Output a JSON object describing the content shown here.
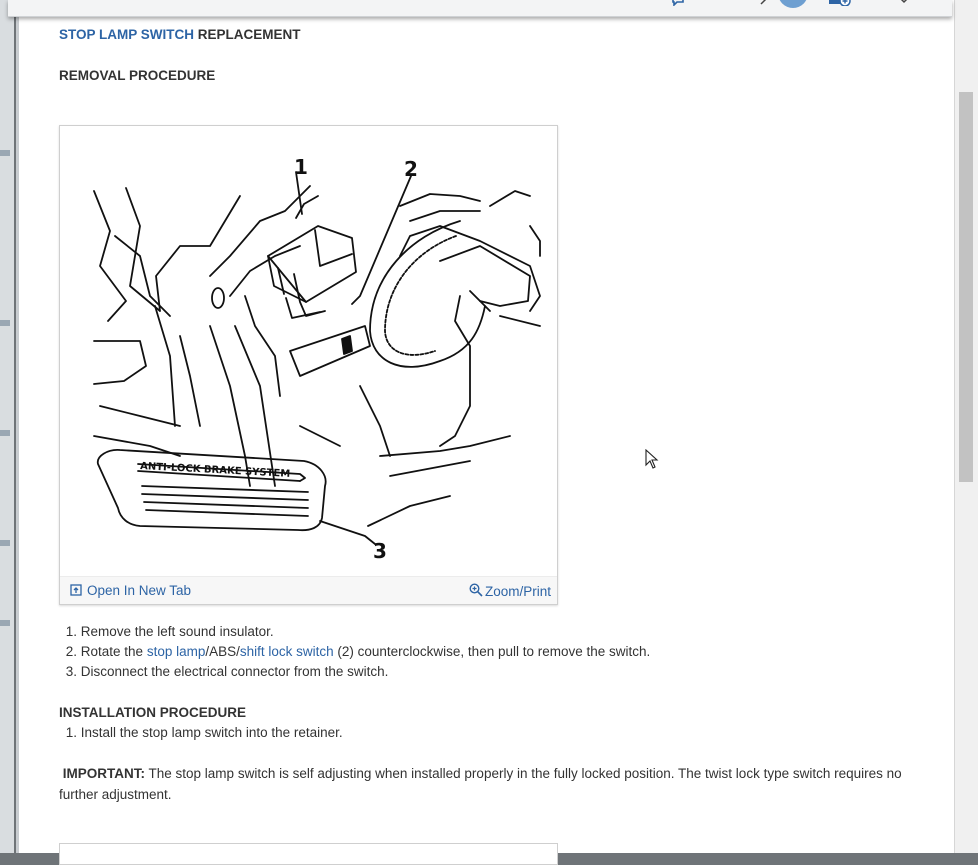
{
  "title": {
    "link_part": "STOP LAMP SWITCH",
    "rest": " REPLACEMENT"
  },
  "removal_heading": "REMOVAL PROCEDURE",
  "figure": {
    "labels": [
      "1",
      "2",
      "3"
    ],
    "panel_text": "ANTI-LOCK BRAKE SYSTEM",
    "open_new_tab": "Open In New Tab",
    "zoom_print": "Zoom/Print"
  },
  "removal_steps": [
    {
      "num": "1.",
      "text": "Remove the left sound insulator."
    },
    {
      "num": "2.",
      "pre": "Rotate the ",
      "link1": "stop lamp",
      "mid": "/ABS/",
      "link2": "shift lock switch",
      "post": " (2) counterclockwise, then pull to remove the switch."
    },
    {
      "num": "3.",
      "text": "Disconnect the electrical connector from the switch."
    }
  ],
  "installation_heading": "INSTALLATION PROCEDURE",
  "installation_steps": [
    {
      "num": "1.",
      "text": "Install the stop lamp switch into the retainer."
    }
  ],
  "important": {
    "label": "IMPORTANT:",
    "text": " The stop lamp switch is self adjusting when installed properly in the fully locked position. The twist lock type switch requires no further adjustment."
  },
  "colors": {
    "link": "#2d64a5",
    "text": "#333333",
    "avatar": "#6e9fd1"
  }
}
